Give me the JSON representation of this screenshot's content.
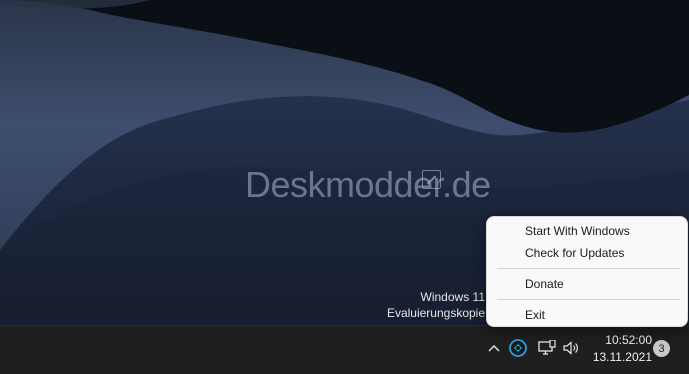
{
  "desktop": {
    "watermark_text": "Deskmodder.de",
    "eval_lines": [
      "Windows 11",
      "Evaluierungskopie"
    ]
  },
  "context_menu": {
    "items": [
      "Start With Windows",
      "Check for Updates",
      "Donate",
      "Exit"
    ]
  },
  "taskbar": {
    "clock_time": "10:52:00",
    "clock_date": "13.11.2021",
    "notification_count": "3",
    "icons": [
      "chevron-up-icon",
      "app-tray-icon",
      "network-icon",
      "volume-icon"
    ]
  },
  "colors": {
    "taskbar_bg": "#1f1f1f",
    "menu_bg": "#f9f9f9",
    "menu_text": "#1b1b1b",
    "tray_app_accent": "#29a3e0"
  }
}
